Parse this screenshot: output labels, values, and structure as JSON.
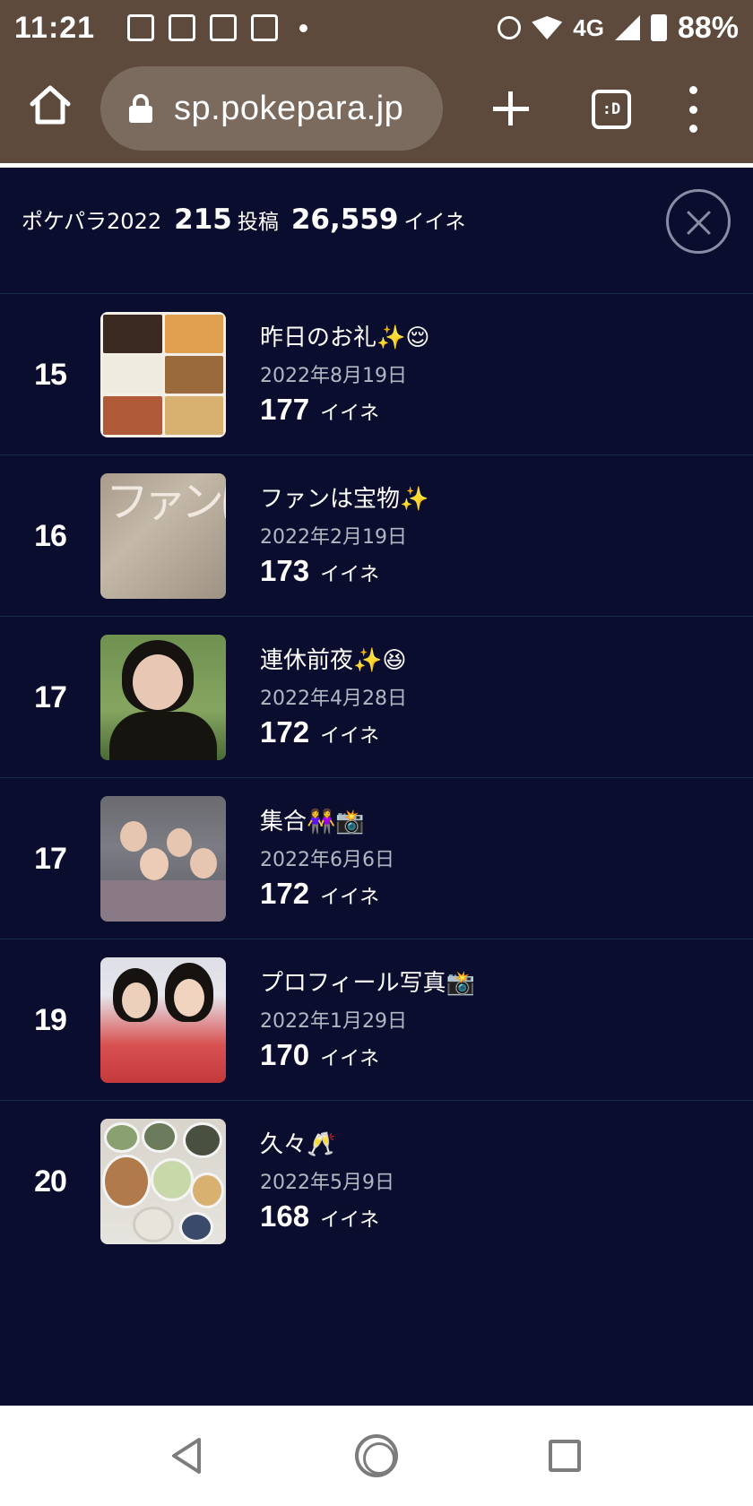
{
  "status_bar": {
    "time": "11:21",
    "network": "4G",
    "battery": "88%"
  },
  "browser": {
    "url": "sp.pokepara.jp",
    "tab_switcher_label": ":D"
  },
  "summary": {
    "title": "ポケパラ2022",
    "posts_count": "215",
    "posts_unit": "投稿",
    "likes_count": "26,559",
    "likes_unit": "イイネ"
  },
  "posts": [
    {
      "rank": "15",
      "title": "昨日のお礼✨😌",
      "date": "2022年8月19日",
      "likes": "177",
      "likes_unit": "イイネ"
    },
    {
      "rank": "16",
      "title": "ファンは宝物✨",
      "date": "2022年2月19日",
      "likes": "173",
      "likes_unit": "イイネ"
    },
    {
      "rank": "17",
      "title": "連休前夜✨😆",
      "date": "2022年4月28日",
      "likes": "172",
      "likes_unit": "イイネ"
    },
    {
      "rank": "17",
      "title": "集合👭📸",
      "date": "2022年6月6日",
      "likes": "172",
      "likes_unit": "イイネ"
    },
    {
      "rank": "19",
      "title": "プロフィール写真📸",
      "date": "2022年1月29日",
      "likes": "170",
      "likes_unit": "イイネ"
    },
    {
      "rank": "20",
      "title": "久々🥂",
      "date": "2022年5月9日",
      "likes": "168",
      "likes_unit": "イイネ"
    }
  ],
  "thumbnail_text": "ファンは宝物",
  "colors": {
    "browser_chrome": "#5d4a3c",
    "page_background": "#0b0d2e",
    "row_divider": "#1c2a4a",
    "date_text": "#b4b6c4"
  }
}
